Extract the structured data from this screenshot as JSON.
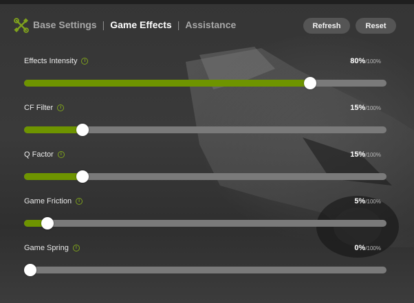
{
  "colors": {
    "accent": "#6e9400",
    "track": "#7a7a7a",
    "thumb": "#ffffff",
    "button_bg": "#555555"
  },
  "header": {
    "logo_icon": "crossed-tools-icon",
    "tabs": [
      {
        "label": "Base Settings",
        "active": false
      },
      {
        "label": "Game Effects",
        "active": true
      },
      {
        "label": "Assistance",
        "active": false
      }
    ],
    "separator": "|",
    "refresh_label": "Refresh",
    "reset_label": "Reset"
  },
  "info_icon": "info-circle-icon",
  "settings": [
    {
      "label": "Effects Intensity",
      "value": 80,
      "value_text": "80%",
      "max_text": "/100%"
    },
    {
      "label": "CF Filter",
      "value": 15,
      "value_text": "15%",
      "max_text": "/100%"
    },
    {
      "label": "Q Factor",
      "value": 15,
      "value_text": "15%",
      "max_text": "/100%"
    },
    {
      "label": "Game Friction",
      "value": 5,
      "value_text": "5%",
      "max_text": "/100%"
    },
    {
      "label": "Game Spring",
      "value": 0,
      "value_text": "0%",
      "max_text": "/100%"
    }
  ]
}
